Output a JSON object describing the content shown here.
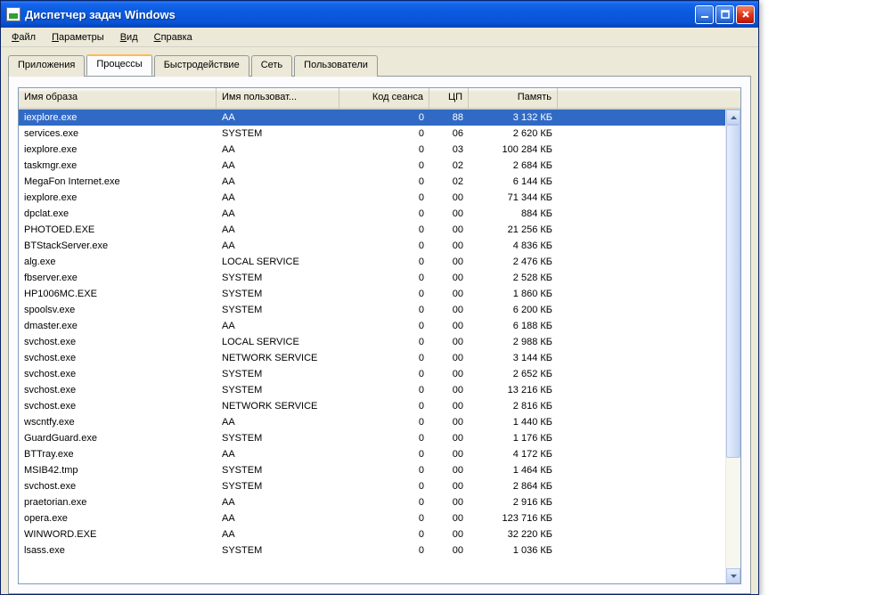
{
  "window": {
    "title": "Диспетчер задач Windows"
  },
  "menu": {
    "file": {
      "label": "Файл",
      "ul": "Ф"
    },
    "params": {
      "label": "Параметры",
      "ul": "П"
    },
    "view": {
      "label": "Вид",
      "ul": "В"
    },
    "help": {
      "label": "Справка",
      "ul": "С"
    }
  },
  "tabs": {
    "apps": {
      "label": "Приложения"
    },
    "procs": {
      "label": "Процессы"
    },
    "perf": {
      "label": "Быстродействие"
    },
    "network": {
      "label": "Сеть"
    },
    "users": {
      "label": "Пользователи"
    }
  },
  "columns": {
    "image": "Имя образа",
    "user": "Имя пользоват...",
    "sess": "Код сеанса",
    "cpu": "ЦП",
    "mem": "Память"
  },
  "rows": [
    {
      "image": "iexplore.exe",
      "user": "AA",
      "sess": "0",
      "cpu": "88",
      "mem": "3 132 КБ",
      "selected": true
    },
    {
      "image": "services.exe",
      "user": "SYSTEM",
      "sess": "0",
      "cpu": "06",
      "mem": "2 620 КБ"
    },
    {
      "image": "iexplore.exe",
      "user": "AA",
      "sess": "0",
      "cpu": "03",
      "mem": "100 284 КБ"
    },
    {
      "image": "taskmgr.exe",
      "user": "AA",
      "sess": "0",
      "cpu": "02",
      "mem": "2 684 КБ"
    },
    {
      "image": "MegaFon Internet.exe",
      "user": "AA",
      "sess": "0",
      "cpu": "02",
      "mem": "6 144 КБ"
    },
    {
      "image": "iexplore.exe",
      "user": "AA",
      "sess": "0",
      "cpu": "00",
      "mem": "71 344 КБ"
    },
    {
      "image": "dpclat.exe",
      "user": "AA",
      "sess": "0",
      "cpu": "00",
      "mem": "884 КБ"
    },
    {
      "image": "PHOTOED.EXE",
      "user": "AA",
      "sess": "0",
      "cpu": "00",
      "mem": "21 256 КБ"
    },
    {
      "image": "BTStackServer.exe",
      "user": "AA",
      "sess": "0",
      "cpu": "00",
      "mem": "4 836 КБ"
    },
    {
      "image": "alg.exe",
      "user": "LOCAL SERVICE",
      "sess": "0",
      "cpu": "00",
      "mem": "2 476 КБ"
    },
    {
      "image": "fbserver.exe",
      "user": "SYSTEM",
      "sess": "0",
      "cpu": "00",
      "mem": "2 528 КБ"
    },
    {
      "image": "HP1006MC.EXE",
      "user": "SYSTEM",
      "sess": "0",
      "cpu": "00",
      "mem": "1 860 КБ"
    },
    {
      "image": "spoolsv.exe",
      "user": "SYSTEM",
      "sess": "0",
      "cpu": "00",
      "mem": "6 200 КБ"
    },
    {
      "image": "dmaster.exe",
      "user": "AA",
      "sess": "0",
      "cpu": "00",
      "mem": "6 188 КБ"
    },
    {
      "image": "svchost.exe",
      "user": "LOCAL SERVICE",
      "sess": "0",
      "cpu": "00",
      "mem": "2 988 КБ"
    },
    {
      "image": "svchost.exe",
      "user": "NETWORK SERVICE",
      "sess": "0",
      "cpu": "00",
      "mem": "3 144 КБ"
    },
    {
      "image": "svchost.exe",
      "user": "SYSTEM",
      "sess": "0",
      "cpu": "00",
      "mem": "2 652 КБ"
    },
    {
      "image": "svchost.exe",
      "user": "SYSTEM",
      "sess": "0",
      "cpu": "00",
      "mem": "13 216 КБ"
    },
    {
      "image": "svchost.exe",
      "user": "NETWORK SERVICE",
      "sess": "0",
      "cpu": "00",
      "mem": "2 816 КБ"
    },
    {
      "image": "wscntfy.exe",
      "user": "AA",
      "sess": "0",
      "cpu": "00",
      "mem": "1 440 КБ"
    },
    {
      "image": "GuardGuard.exe",
      "user": "SYSTEM",
      "sess": "0",
      "cpu": "00",
      "mem": "1 176 КБ"
    },
    {
      "image": "BTTray.exe",
      "user": "AA",
      "sess": "0",
      "cpu": "00",
      "mem": "4 172 КБ"
    },
    {
      "image": "MSIB42.tmp",
      "user": "SYSTEM",
      "sess": "0",
      "cpu": "00",
      "mem": "1 464 КБ"
    },
    {
      "image": "svchost.exe",
      "user": "SYSTEM",
      "sess": "0",
      "cpu": "00",
      "mem": "2 864 КБ"
    },
    {
      "image": "praetorian.exe",
      "user": "AA",
      "sess": "0",
      "cpu": "00",
      "mem": "2 916 КБ"
    },
    {
      "image": "opera.exe",
      "user": "AA",
      "sess": "0",
      "cpu": "00",
      "mem": "123 716 КБ"
    },
    {
      "image": "WINWORD.EXE",
      "user": "AA",
      "sess": "0",
      "cpu": "00",
      "mem": "32 220 КБ"
    },
    {
      "image": "lsass.exe",
      "user": "SYSTEM",
      "sess": "0",
      "cpu": "00",
      "mem": "1 036 КБ"
    }
  ]
}
